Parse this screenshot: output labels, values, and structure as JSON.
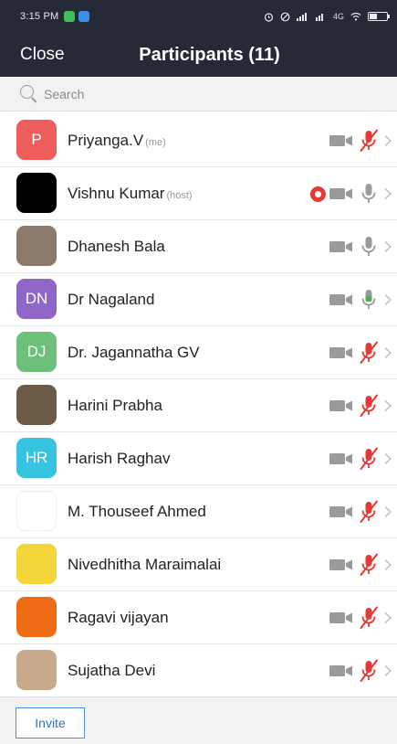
{
  "status_bar": {
    "time": "3:15 PM",
    "network": "4G",
    "colors": {
      "background": "#252a36"
    }
  },
  "header": {
    "close_label": "Close",
    "title": "Participants (11)"
  },
  "search": {
    "placeholder": "Search"
  },
  "participants": [
    {
      "name": "Priyanga.V",
      "tag": "(me)",
      "avatar_initials": "P",
      "avatar_color": "#ef5c5c",
      "recording": false,
      "mic": "muted"
    },
    {
      "name": "Vishnu Kumar",
      "tag": "(host)",
      "avatar_initials": "",
      "avatar_color": "#000000",
      "recording": true,
      "mic": "off"
    },
    {
      "name": "Dhanesh Bala",
      "tag": "",
      "avatar_initials": "",
      "avatar_color": "#8c7b6b",
      "recording": false,
      "mic": "off"
    },
    {
      "name": "Dr Nagaland",
      "tag": "",
      "avatar_initials": "DN",
      "avatar_color": "#8e67c9",
      "recording": false,
      "mic": "active"
    },
    {
      "name": "Dr. Jagannatha GV",
      "tag": "",
      "avatar_initials": "DJ",
      "avatar_color": "#6cc07a",
      "recording": false,
      "mic": "muted"
    },
    {
      "name": "Harini Prabha",
      "tag": "",
      "avatar_initials": "",
      "avatar_color": "#6b5a44",
      "recording": false,
      "mic": "muted"
    },
    {
      "name": "Harish Raghav",
      "tag": "",
      "avatar_initials": "HR",
      "avatar_color": "#35c3e0",
      "recording": false,
      "mic": "muted"
    },
    {
      "name": "M. Thouseef Ahmed",
      "tag": "",
      "avatar_initials": "",
      "avatar_color": "#ffffff",
      "recording": false,
      "mic": "muted"
    },
    {
      "name": "Nivedhitha Maraimalai",
      "tag": "",
      "avatar_initials": "",
      "avatar_color": "#f4d53a",
      "recording": false,
      "mic": "muted"
    },
    {
      "name": "Ragavi vijayan",
      "tag": "",
      "avatar_initials": "",
      "avatar_color": "#ef6b14",
      "recording": false,
      "mic": "muted"
    },
    {
      "name": "Sujatha Devi",
      "tag": "",
      "avatar_initials": "",
      "avatar_color": "#c9a98c",
      "recording": false,
      "mic": "muted"
    }
  ],
  "icons": {
    "video": "video-camera-icon",
    "mic_muted": "mic-muted-icon",
    "mic_active": "mic-active-icon",
    "record": "recording-icon",
    "chevron": "chevron-right-icon"
  },
  "colors": {
    "header": "#252a36",
    "muted_mic": "#e53935",
    "active_mic": "#4caf50",
    "invite_border": "#4a90d9"
  },
  "footer": {
    "invite_label": "Invite"
  }
}
